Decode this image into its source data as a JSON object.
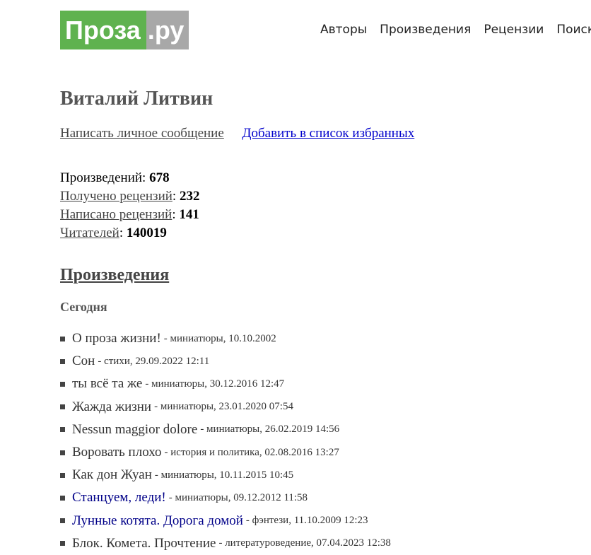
{
  "logo": {
    "main": "Проза",
    "tail": ".ру"
  },
  "nav": [
    "Авторы",
    "Произведения",
    "Рецензии",
    "Поиск"
  ],
  "author": {
    "name": "Виталий Литвин"
  },
  "actions": {
    "message": "Написать личное сообщение",
    "favorite": "Добавить в список избранных"
  },
  "stats": {
    "works_label": "Произведений",
    "works_value": "678",
    "received_label": "Получено рецензий",
    "received_value": "232",
    "written_label": "Написано рецензий",
    "written_value": "141",
    "readers_label": "Читателей",
    "readers_value": "140019"
  },
  "section": {
    "title": "Произведения",
    "subtitle": "Сегодня"
  },
  "works": [
    {
      "title": "О проза жизни!",
      "meta": "- миниатюры, 10.10.2002"
    },
    {
      "title": "Сон",
      "meta": "- стихи, 29.09.2022 12:11"
    },
    {
      "title": "ты всё та же",
      "meta": "- миниатюры, 30.12.2016 12:47"
    },
    {
      "title": "Жажда жизни",
      "meta": "- миниатюры, 23.01.2020 07:54"
    },
    {
      "title": "Nessun maggior dolore",
      "meta": "- миниатюры, 26.02.2019 14:56"
    },
    {
      "title": "Воровать плохо",
      "meta": "- история и политика, 02.08.2016 13:27"
    },
    {
      "title": "Как дон Жуан",
      "meta": "- миниатюры, 10.11.2015 10:45"
    },
    {
      "title": "Станцуем, леди!",
      "meta": "- миниатюры, 09.12.2012 11:58"
    },
    {
      "title": "Лунные котята. Дорога домой",
      "meta": "- фэнтези, 11.10.2009 12:23"
    },
    {
      "title": "Блок. Комета. Прочтение",
      "meta": "- литературоведение, 07.04.2023 12:38"
    }
  ]
}
